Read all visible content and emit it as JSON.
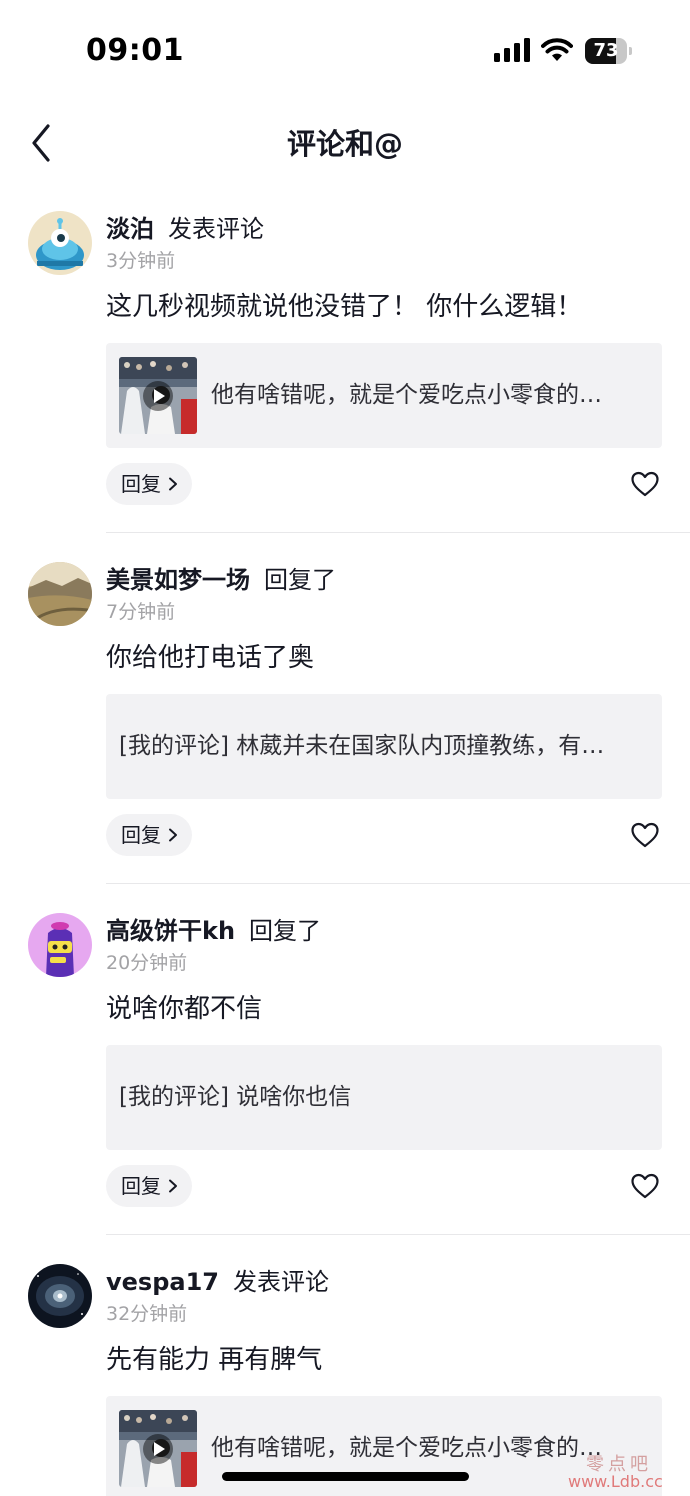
{
  "status_bar": {
    "time": "09:01",
    "battery_level": "73",
    "battery_fraction": 0.73
  },
  "nav": {
    "title": "评论和@",
    "back_icon": "chevron-left-icon"
  },
  "items": [
    {
      "user": "淡泊",
      "action": "发表评论",
      "time": "3分钟前",
      "comment": "这几秒视频就说他没错了！ 你什么逻辑！",
      "ref_text": "他有啥错呢，就是个爱吃点小零食的…",
      "has_thumb": true,
      "reply_label": "回复",
      "avatar_icon": "cartoon-alien-avatar"
    },
    {
      "user": "美景如梦一场",
      "action": "回复了",
      "time": "7分钟前",
      "comment": "你给他打电话了奥",
      "ref_text": "[我的评论] 林葳并未在国家队内顶撞教练，有…",
      "has_thumb": false,
      "reply_label": "回复",
      "avatar_icon": "landscape-avatar"
    },
    {
      "user": "高级饼干kh",
      "action": "回复了",
      "time": "20分钟前",
      "comment": "说啥你都不信",
      "ref_text": "[我的评论] 说啥你也信",
      "has_thumb": false,
      "reply_label": "回复",
      "avatar_icon": "purple-cartoon-avatar"
    },
    {
      "user": "vespa17",
      "action": "发表评论",
      "time": "32分钟前",
      "comment": "先有能力 再有脾气",
      "ref_text": "他有啥错呢，就是个爱吃点小零食的…",
      "has_thumb": true,
      "reply_label": "回复",
      "avatar_icon": "galaxy-avatar"
    }
  ],
  "watermark": {
    "line1": "零点吧",
    "line2": "www.Ldb.cc"
  },
  "colors": {
    "text": "#161823",
    "secondary": "#a3a3a6",
    "card_bg": "#f2f2f4"
  }
}
